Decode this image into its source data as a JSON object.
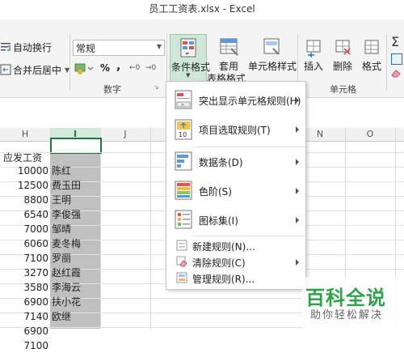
{
  "window": {
    "title": "员工工资表.xlsx - Excel"
  },
  "ribbon": {
    "wrap_text": "自动换行",
    "merge_center": "合并后居中",
    "number_format": "常规",
    "percent_symbol": "%",
    "comma_symbol": ",",
    "number_group": "数字",
    "conditional_format": "条件格式",
    "table_format_line1": "套用",
    "table_format_line2": "表格格式",
    "cell_styles": "单元格样式",
    "insert": "插入",
    "delete": "删除",
    "format": "格式",
    "cells_group": "单元格"
  },
  "columns": [
    "H",
    "I",
    "J",
    "N",
    "O"
  ],
  "selected_cell_text": "",
  "table": {
    "header": "应发工资",
    "rows": [
      {
        "salary": "10000",
        "name": "陈红"
      },
      {
        "salary": "12500",
        "name": "费玉田"
      },
      {
        "salary": "8800",
        "name": "王明"
      },
      {
        "salary": "6540",
        "name": "李俊强"
      },
      {
        "salary": "7000",
        "name": "邹晴"
      },
      {
        "salary": "6060",
        "name": "麦冬梅"
      },
      {
        "salary": "7100",
        "name": "罗丽"
      },
      {
        "salary": "3270",
        "name": "赵红霞"
      },
      {
        "salary": "3580",
        "name": "李海云"
      },
      {
        "salary": "6900",
        "name": "扶小花"
      },
      {
        "salary": "7140",
        "name": "欧继"
      },
      {
        "salary": "6900",
        "name": ""
      },
      {
        "salary": "7100",
        "name": ""
      }
    ]
  },
  "menu": {
    "highlight_cells": "突出显示单元格规则(H)",
    "top_bottom": "项目选取规则(T)",
    "data_bars": "数据条(D)",
    "color_scales": "色阶(S)",
    "icon_sets": "图标集(I)",
    "new_rule": "新建规则(N)...",
    "clear_rules": "清除规则(C)",
    "manage_rules": "管理规则(R)...",
    "top_icon_text": "10"
  },
  "watermark": {
    "title": "百科全说",
    "subtitle": "助你轻松解决"
  },
  "colors": {
    "accent": "#217346",
    "selected_button": "#cfe7d7",
    "selected_column": "#c0c0c0",
    "watermark": "#2fa24a"
  }
}
